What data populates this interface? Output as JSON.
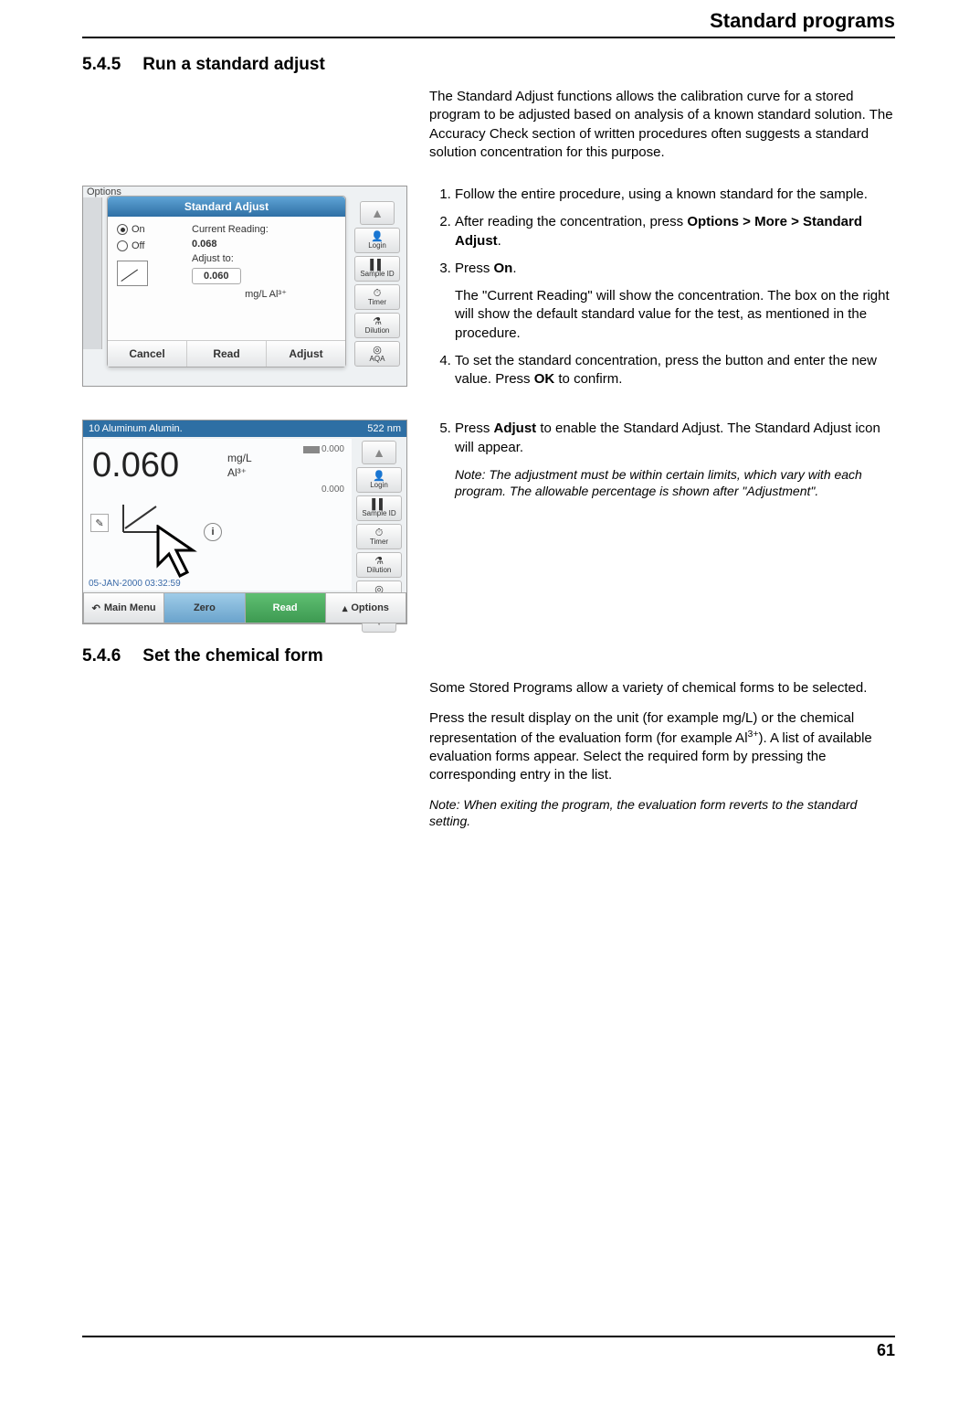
{
  "header": {
    "title": "Standard programs"
  },
  "section1": {
    "number": "5.4.5",
    "title": "Run a standard adjust",
    "intro": "The Standard Adjust functions allows the calibration curve for a stored program to be adjusted based on analysis of a known standard solution. The Accuracy Check section of written procedures often suggests a standard solution concentration for this purpose.",
    "steps": {
      "s1": "Follow the entire procedure, using a known standard for the sample.",
      "s2_a": "After reading the concentration, press ",
      "s2_b": "Options > More > Standard Adjust",
      "s2_c": ".",
      "s3_a": "Press ",
      "s3_b": "On",
      "s3_c": ".",
      "s3_after": "The \"Current Reading\" will show the concentration. The box on the right will show the default standard value for the test, as mentioned in the procedure.",
      "s4_a": "To set the standard concentration, press the button and enter the new value. Press ",
      "s4_b": "OK",
      "s4_c": " to confirm.",
      "s5_a": "Press ",
      "s5_b": "Adjust",
      "s5_c": " to enable the Standard Adjust. The Standard Adjust icon will appear.",
      "s5_note": "Note: The adjustment must be within certain limits, which vary with each program. The allowable percentage is shown after \"Adjustment\"."
    }
  },
  "shot1": {
    "options": "Options",
    "dialog_title": "Standard Adjust",
    "on": "On",
    "off": "Off",
    "current_reading_label": "Current Reading:",
    "current_reading": "0.068",
    "adjust_to": "Adjust to:",
    "adjust_value": "0.060",
    "unit": "mg/L Al³⁺",
    "btn_cancel": "Cancel",
    "btn_read": "Read",
    "btn_adjust": "Adjust",
    "side": {
      "login": "Login",
      "sampleid": "Sample ID",
      "timer": "Timer",
      "dilution": "Dilution",
      "aqa": "AQA"
    }
  },
  "shot2": {
    "topline_left": "10 Aluminum Alumin.",
    "topline_right": "522 nm",
    "value": "0.060",
    "unit1": "mg/L",
    "unit2": "Al³⁺",
    "upper": "0.000",
    "lower": "0.000",
    "date": "05-JAN-2000  03:32:59",
    "btn_main": "Main Menu",
    "btn_zero": "Zero",
    "btn_read": "Read",
    "btn_options": "Options",
    "side": {
      "login": "Login",
      "sampleid": "Sample ID",
      "timer": "Timer",
      "dilution": "Dilution",
      "aqa": "AQA"
    }
  },
  "section2": {
    "number": "5.4.6",
    "title": "Set the chemical form",
    "p1": "Some Stored Programs allow a variety of chemical forms to be selected.",
    "p2_a": "Press the result display on the unit (for example mg/L) or the chemical representation of the evaluation form (for example Al",
    "p2_sup": "3+",
    "p2_b": "). A list of available evaluation forms appear. Select the required form by pressing the corresponding entry in the list.",
    "note": "Note: When exiting the program, the evaluation form reverts to the standard setting."
  },
  "page_number": "61"
}
